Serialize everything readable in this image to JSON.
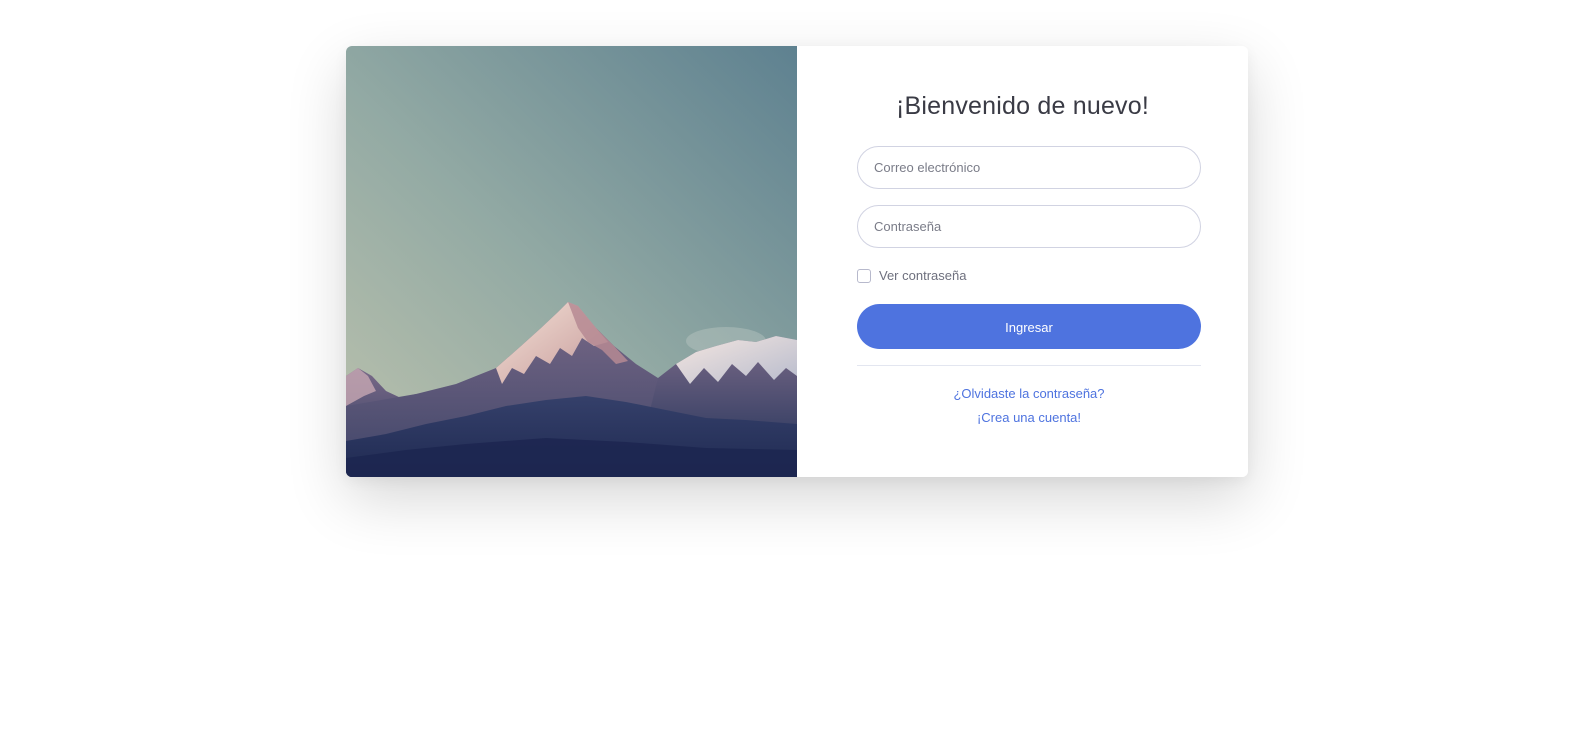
{
  "login": {
    "title": "¡Bienvenido de nuevo!",
    "email_placeholder": "Correo electrónico",
    "password_placeholder": "Contraseña",
    "show_password_label": "Ver contraseña",
    "submit_label": "Ingresar",
    "forgot_password_link": "¿Olvidaste la contraseña?",
    "create_account_link": "¡Crea una cuenta!"
  },
  "colors": {
    "primary": "#4e73df",
    "title_text": "#3a3b45",
    "muted_text": "#6e707e",
    "input_border": "#d1d3e2"
  },
  "image": {
    "subject": "mountain-landscape"
  }
}
